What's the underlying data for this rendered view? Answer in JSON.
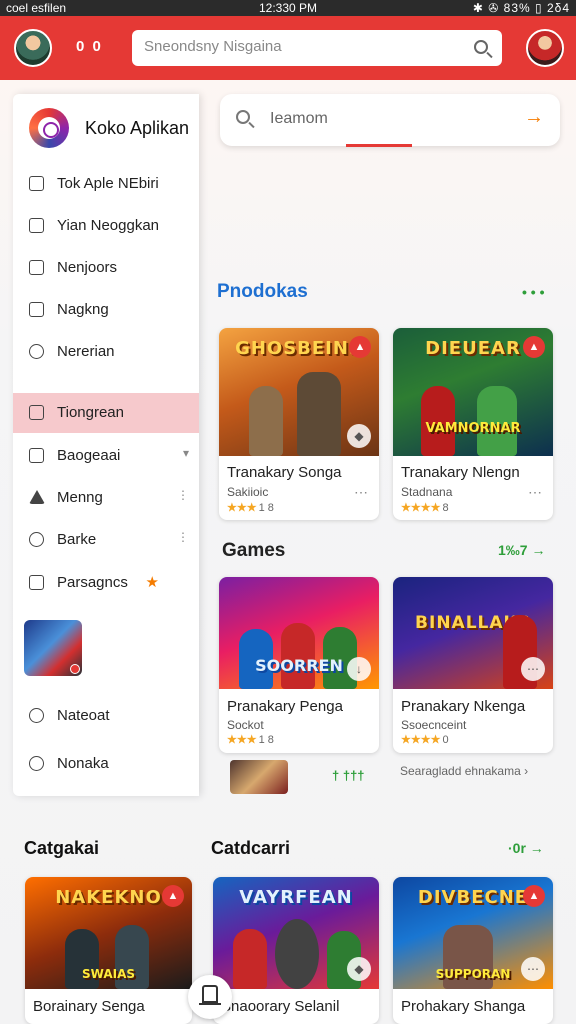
{
  "status_bar": {
    "left": "coel esfilen",
    "time": "12:330 PM",
    "right": "✱ ✇ 83% ▯ 2δ4"
  },
  "top_bar": {
    "badge_text": "0 0",
    "search_placeholder": "Sneondsny Nisgaina",
    "search_icon": "search-icon"
  },
  "search_main": {
    "placeholder": "Ieamom",
    "arrow": "→"
  },
  "sections": {
    "products": {
      "title": "Pnodokas",
      "link": "• • •"
    },
    "games": {
      "title": "Games",
      "link": "1‰7 →"
    },
    "categories_left": {
      "title": "Catgakai"
    },
    "categories_right": {
      "title": "Catdcarri",
      "link": "·0r →"
    }
  },
  "drawer": {
    "app_name": "Koko Aplikan",
    "items": [
      {
        "label": "Tok Aple NEbiri",
        "icon": "share-icon",
        "trail": ""
      },
      {
        "label": "Yian Neoggkan",
        "icon": "checkbox-icon",
        "trail": ""
      },
      {
        "label": "Nenjoors",
        "icon": "download-icon",
        "trail": ""
      },
      {
        "label": "Nagkng",
        "icon": "info-icon",
        "trail": ""
      },
      {
        "label": "Nererian",
        "icon": "bell-icon",
        "trail": ""
      },
      {
        "label": "Tiongrean",
        "icon": "image-icon",
        "trail": ""
      },
      {
        "label": "Baogeaai",
        "icon": "edit-icon",
        "trail": "▾"
      },
      {
        "label": "Menng",
        "icon": "warning-icon",
        "trail": "⋮"
      },
      {
        "label": "Barke",
        "icon": "clock-icon",
        "trail": "⋮"
      },
      {
        "label": "Parsagncs",
        "icon": "gift-icon",
        "trail": "★"
      },
      {
        "label": "Nateoat",
        "icon": "settings-icon",
        "trail": ""
      },
      {
        "label": "Nonaka",
        "icon": "help-icon",
        "trail": ""
      }
    ]
  },
  "product_cards": [
    {
      "art_top": "GHOSBEINS",
      "art_bottom": "",
      "title": "Tranakary Songa",
      "sub": "Sakiioic",
      "stars": "★★★",
      "rating": "1 8"
    },
    {
      "art_top": "DIEUEAR",
      "art_bottom": "VAMNORNAR",
      "title": "Tranakary Nlengn",
      "sub": "Stadnana",
      "stars": "★★★★",
      "rating": "8"
    }
  ],
  "game_cards": [
    {
      "art_top": "",
      "art_bottom": "SOORREN",
      "title": "Pranakary Penga",
      "sub": "Sockot",
      "stars": "★★★",
      "rating": "1 8"
    },
    {
      "art_top": "BINALLAKS",
      "art_bottom": "",
      "title": "Pranakary Nkenga",
      "sub": "Ssoecnceint",
      "stars": "★★★★",
      "rating": "0"
    }
  ],
  "ad_row": {
    "mid": "† †††",
    "text": "Searagladd ehnakama ›"
  },
  "bottom_cards": [
    {
      "art_top": "NAKEKNO",
      "art_bottom": "SWAIAS",
      "title": "Borainary Senga"
    },
    {
      "art_top": "VAYRFEAN",
      "art_bottom": "",
      "title": "Snaoorary Selanil"
    },
    {
      "art_top": "DIVBECNE",
      "art_bottom": "SUPPORAN",
      "title": "Prohakary Shanga"
    }
  ],
  "colors": {
    "brand_red": "#e53935",
    "accent_orange": "#f57c00",
    "link_green": "#2e9e3a",
    "title_blue": "#1e6fd1"
  }
}
